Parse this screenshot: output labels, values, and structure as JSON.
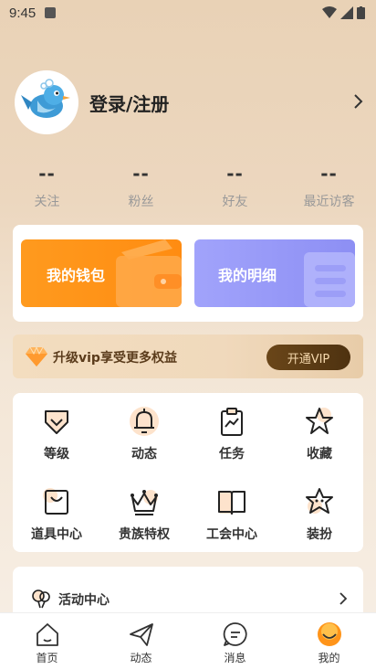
{
  "status_bar": {
    "time": "9:45"
  },
  "profile": {
    "login_label": "登录/注册"
  },
  "stats": [
    {
      "value": "--",
      "label": "关注"
    },
    {
      "value": "--",
      "label": "粉丝"
    },
    {
      "value": "--",
      "label": "好友"
    },
    {
      "value": "--",
      "label": "最近访客"
    }
  ],
  "wallet": {
    "my_wallet": "我的钱包",
    "my_details": "我的明细"
  },
  "vip": {
    "promo_text": "升级vip享受更多权益",
    "button_label": "开通VIP"
  },
  "grid": [
    {
      "label": "等级",
      "icon": "level-shield-icon"
    },
    {
      "label": "动态",
      "icon": "bell-icon"
    },
    {
      "label": "任务",
      "icon": "task-clipboard-icon"
    },
    {
      "label": "收藏",
      "icon": "star-icon"
    },
    {
      "label": "道具中心",
      "icon": "shopping-bag-icon"
    },
    {
      "label": "贵族特权",
      "icon": "crown-icon"
    },
    {
      "label": "工会中心",
      "icon": "book-icon"
    },
    {
      "label": "装扮",
      "icon": "star-sparkle-icon"
    }
  ],
  "activity": {
    "label": "活动中心"
  },
  "tabs": [
    {
      "label": "首页",
      "icon": "home-icon"
    },
    {
      "label": "动态",
      "icon": "paper-plane-icon"
    },
    {
      "label": "消息",
      "icon": "message-icon"
    },
    {
      "label": "我的",
      "icon": "profile-face-icon",
      "active": true
    }
  ],
  "colors": {
    "accent_orange": "#ff9419",
    "accent_purple": "#9597f8",
    "vip_brown": "#5b3c1c",
    "grid_icon_highlight": "#fde3cc"
  }
}
